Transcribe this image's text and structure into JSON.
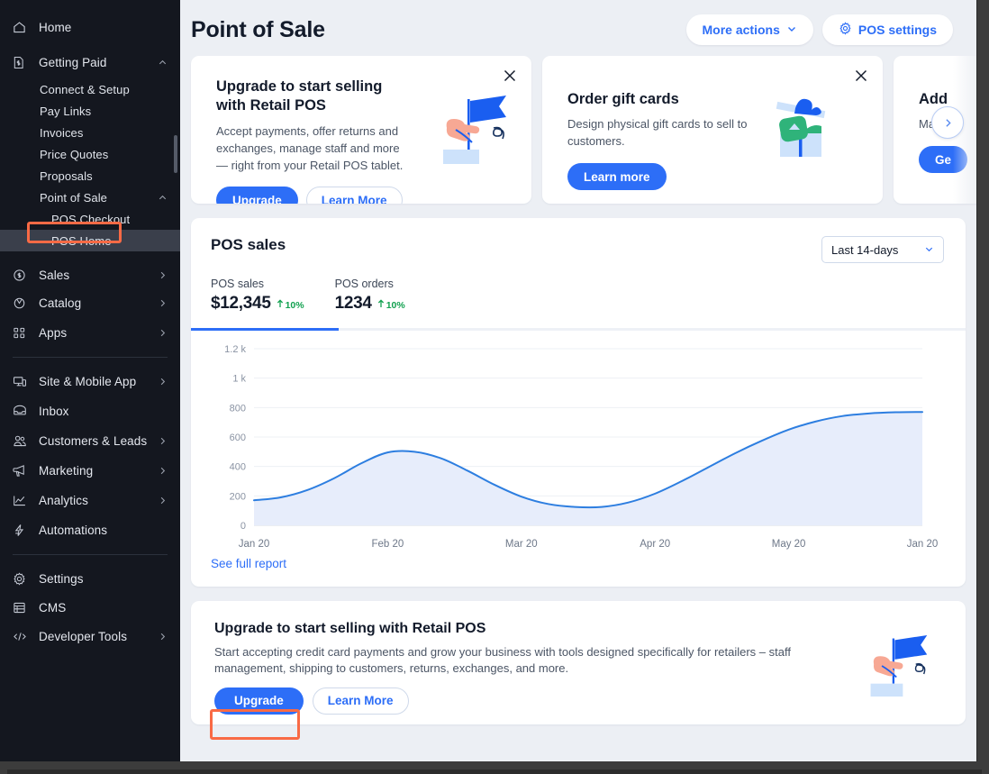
{
  "sidebar": {
    "items": [
      {
        "label": "Home",
        "icon": "home-icon",
        "chevron": "none",
        "level": 0
      },
      {
        "label": "Getting Paid",
        "icon": "receipt-dollar-icon",
        "chevron": "up",
        "level": 0
      },
      {
        "label": "Connect & Setup",
        "icon": "",
        "chevron": "none",
        "level": 1
      },
      {
        "label": "Pay Links",
        "icon": "",
        "chevron": "none",
        "level": 1
      },
      {
        "label": "Invoices",
        "icon": "",
        "chevron": "none",
        "level": 1
      },
      {
        "label": "Price Quotes",
        "icon": "",
        "chevron": "none",
        "level": 1
      },
      {
        "label": "Proposals",
        "icon": "",
        "chevron": "none",
        "level": 1
      },
      {
        "label": "Point of Sale",
        "icon": "",
        "chevron": "up",
        "level": 1
      },
      {
        "label": "POS Checkout",
        "icon": "",
        "chevron": "none",
        "level": 2
      },
      {
        "label": "POS Home",
        "icon": "",
        "chevron": "none",
        "level": 2,
        "active": true,
        "highlighted": true
      },
      {
        "label": "Sales",
        "icon": "dollar-circle-icon",
        "chevron": "right",
        "level": 0
      },
      {
        "label": "Catalog",
        "icon": "tag-icon",
        "chevron": "right",
        "level": 0
      },
      {
        "label": "Apps",
        "icon": "apps-grid-icon",
        "chevron": "right",
        "level": 0
      },
      {
        "label": "Site & Mobile App",
        "icon": "monitor-mobile-icon",
        "chevron": "right",
        "level": 0
      },
      {
        "label": "Inbox",
        "icon": "inbox-icon",
        "chevron": "none",
        "level": 0
      },
      {
        "label": "Customers & Leads",
        "icon": "people-icon",
        "chevron": "right",
        "level": 0
      },
      {
        "label": "Marketing",
        "icon": "megaphone-icon",
        "chevron": "right",
        "level": 0
      },
      {
        "label": "Analytics",
        "icon": "chart-line-icon",
        "chevron": "right",
        "level": 0
      },
      {
        "label": "Automations",
        "icon": "bolt-icon",
        "chevron": "none",
        "level": 0
      },
      {
        "label": "Settings",
        "icon": "gear-icon",
        "chevron": "none",
        "level": 0
      },
      {
        "label": "CMS",
        "icon": "database-icon",
        "chevron": "none",
        "level": 0
      },
      {
        "label": "Developer Tools",
        "icon": "code-icon",
        "chevron": "right",
        "level": 0
      }
    ]
  },
  "header": {
    "title": "Point of Sale",
    "more_actions_label": "More actions",
    "pos_settings_label": "POS settings",
    "gear_icon": "gear-icon",
    "chevron_icon": "chevron-down-icon"
  },
  "promo_cards": [
    {
      "title": "Upgrade to start selling with Retail POS",
      "body": "Accept payments, offer returns and exchanges, manage staff and more — right from your Retail POS tablet.",
      "primary_label": "Upgrade",
      "secondary_label": "Learn More",
      "close_icon": "close-icon",
      "art": "hand-flag-illustration"
    },
    {
      "title": "Order gift cards",
      "body": "Design physical gift cards to sell to customers.",
      "primary_label": "Learn more",
      "secondary_label": "",
      "close_icon": "close-icon",
      "art": "gift-box-illustration"
    },
    {
      "title": "Add",
      "body": "Manag",
      "primary_label": "Ge",
      "secondary_label": "",
      "close_icon": "close-icon",
      "art": ""
    }
  ],
  "carousel": {
    "next_icon": "chevron-right-icon"
  },
  "pos_sales": {
    "panel_title": "POS sales",
    "range_value": "Last 14-days",
    "range_chevron": "chevron-down-icon",
    "tabs": [
      {
        "label": "POS sales",
        "value": "$12,345",
        "delta": "10%",
        "delta_arrow": "arrow-up-icon",
        "active": true
      },
      {
        "label": "POS orders",
        "value": "1234",
        "delta": "10%",
        "delta_arrow": "arrow-up-icon",
        "active": false
      }
    ],
    "see_full_report_label": "See full report"
  },
  "chart_data": {
    "type": "area",
    "title": "POS sales",
    "xlabel": "",
    "ylabel": "",
    "grid": true,
    "legend": "none",
    "line_color": "#2d7ee0",
    "fill_color": "#e7edfb",
    "ylim": [
      0,
      1200
    ],
    "ytick_labels": [
      "0",
      "200",
      "400",
      "600",
      "800",
      "1 k",
      "1.2 k"
    ],
    "ytick_values": [
      0,
      200,
      400,
      600,
      800,
      1000,
      1200
    ],
    "categories": [
      "Jan 20",
      "Feb 20",
      "Mar 20",
      "Apr 20",
      "May 20",
      "Jan 20"
    ],
    "x": [
      0,
      1,
      2,
      3,
      4,
      5
    ],
    "series": [
      {
        "name": "POS sales",
        "values": [
          170,
          500,
          120,
          130,
          660,
          760
        ]
      }
    ],
    "dense_x": [
      0,
      0.2,
      0.4,
      0.6,
      0.8,
      1.0,
      1.2,
      1.4,
      1.6,
      1.8,
      2.0,
      2.2,
      2.4,
      2.6,
      2.8,
      3.0,
      3.2,
      3.4,
      3.6,
      3.8,
      4.0,
      4.2,
      4.4,
      4.6,
      4.8,
      5.0
    ],
    "dense_values": [
      170,
      190,
      240,
      320,
      420,
      495,
      500,
      455,
      370,
      275,
      195,
      145,
      125,
      125,
      155,
      215,
      300,
      395,
      490,
      575,
      650,
      705,
      742,
      760,
      768,
      770
    ]
  },
  "bottom_banner": {
    "title": "Upgrade to start selling with Retail POS",
    "body": "Start accepting credit card payments and grow your business with tools designed specifically for retailers – staff management, shipping to customers, returns, exchanges, and more.",
    "primary_label": "Upgrade",
    "secondary_label": "Learn More",
    "art": "hand-flag-illustration",
    "highlighted_button": "Upgrade"
  },
  "colors": {
    "accent": "#2d6ef7",
    "sidebar_bg": "#14171f",
    "page_bg": "#eceff4",
    "highlight_outline": "#f96a45",
    "positive": "#12a150",
    "chart_line": "#2d7ee0"
  }
}
